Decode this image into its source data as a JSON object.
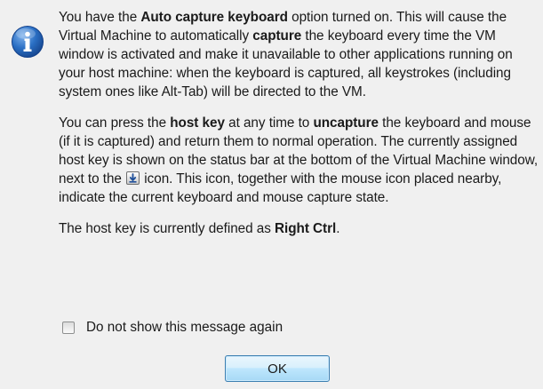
{
  "dialog": {
    "icon": "info-icon",
    "paragraph1": {
      "t1": "You have the ",
      "b1": "Auto capture keyboard",
      "t2": " option turned on. This will cause the Virtual Machine to automatically ",
      "b2": "capture",
      "t3": " the keyboard every time the VM window is activated and make it unavailable to other applications running on your host machine: when the keyboard is captured, all keystrokes (including system ones like Alt-Tab) will be directed to the VM."
    },
    "paragraph2": {
      "t1": "You can press the ",
      "b1": "host key",
      "t2": " at any time to ",
      "b2": "uncapture",
      "t3": " the keyboard and mouse (if it is captured) and return them to normal operation. The currently assigned host key is shown on the status bar at the bottom of the Virtual Machine window, next to the ",
      "icon": "keyboard-capture-icon",
      "t4": " icon. This icon, together with the mouse icon placed nearby, indicate the current keyboard and mouse capture state."
    },
    "paragraph3": {
      "t1": "The host key is currently defined as ",
      "b1": "Right Ctrl",
      "t2": "."
    },
    "checkbox": {
      "label": "Do not show this message again",
      "checked": false
    },
    "ok_button": {
      "label": "OK"
    }
  },
  "colors": {
    "background": "#f0f0f0",
    "icon_blue": "#1f5fb0",
    "button_border": "#3c7fb1"
  }
}
